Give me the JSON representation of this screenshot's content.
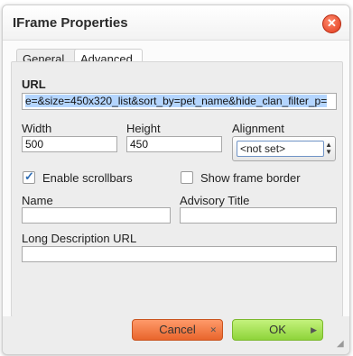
{
  "dialog": {
    "title": "IFrame Properties",
    "close_icon": "✕"
  },
  "tabs": [
    {
      "label": "General"
    },
    {
      "label": "Advanced"
    }
  ],
  "general": {
    "url_label": "URL",
    "url_value": "e=&size=450x320_list&sort_by=pet_name&hide_clan_filter_p=",
    "width_label": "Width",
    "width_value": "500",
    "height_label": "Height",
    "height_value": "450",
    "alignment_label": "Alignment",
    "alignment_value": "<not set>",
    "enable_scrollbars_label": "Enable scrollbars",
    "enable_scrollbars_checked": true,
    "show_frame_border_label": "Show frame border",
    "show_frame_border_checked": false,
    "name_label": "Name",
    "name_value": "",
    "advisory_title_label": "Advisory Title",
    "advisory_title_value": "",
    "long_desc_label": "Long Description URL",
    "long_desc_value": ""
  },
  "footer": {
    "cancel_label": "Cancel",
    "ok_label": "OK"
  },
  "colors": {
    "cancel": "#f07a3f",
    "ok": "#a6e35a",
    "close": "#e0391b"
  }
}
